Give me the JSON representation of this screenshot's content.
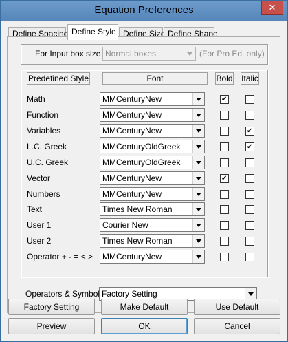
{
  "window": {
    "title": "Equation Preferences",
    "close_label": "✕"
  },
  "tabs": [
    {
      "label": "Define Spacing",
      "active": false
    },
    {
      "label": "Define Style",
      "active": true
    },
    {
      "label": "Define Size",
      "active": false
    },
    {
      "label": "Define Shape",
      "active": false
    }
  ],
  "input_box": {
    "label": "For Input box size :",
    "value": "Normal boxes",
    "note": "(For Pro Ed. only)"
  },
  "style_table": {
    "headers": {
      "style": "Predefined Style",
      "font": "Font",
      "bold": "Bold",
      "italic": "Italic"
    },
    "rows": [
      {
        "style": "Math",
        "font": "MMCenturyNew",
        "bold": true,
        "italic": false
      },
      {
        "style": "Function",
        "font": "MMCenturyNew",
        "bold": false,
        "italic": false
      },
      {
        "style": "Variables",
        "font": "MMCenturyNew",
        "bold": false,
        "italic": true
      },
      {
        "style": "L.C. Greek",
        "font": "MMCenturyOldGreek",
        "bold": false,
        "italic": true
      },
      {
        "style": "U.C. Greek",
        "font": "MMCenturyOldGreek",
        "bold": false,
        "italic": false
      },
      {
        "style": "Vector",
        "font": "MMCenturyNew",
        "bold": true,
        "italic": false
      },
      {
        "style": "Numbers",
        "font": "MMCenturyNew",
        "bold": false,
        "italic": false
      },
      {
        "style": "Text",
        "font": "Times New Roman",
        "bold": false,
        "italic": false
      },
      {
        "style": "User 1",
        "font": "Courier New",
        "bold": false,
        "italic": false
      },
      {
        "style": "User 2",
        "font": "Times New Roman",
        "bold": false,
        "italic": false
      },
      {
        "style": "Operator + - = < >",
        "font": "MMCenturyNew",
        "bold": false,
        "italic": false
      }
    ]
  },
  "operators": {
    "label": "Operators & Symbols:",
    "value": "Factory Setting"
  },
  "buttons": {
    "factory_setting": "Factory Setting",
    "make_default": "Make Default",
    "use_default": "Use Default",
    "preview": "Preview",
    "ok": "OK",
    "cancel": "Cancel"
  }
}
